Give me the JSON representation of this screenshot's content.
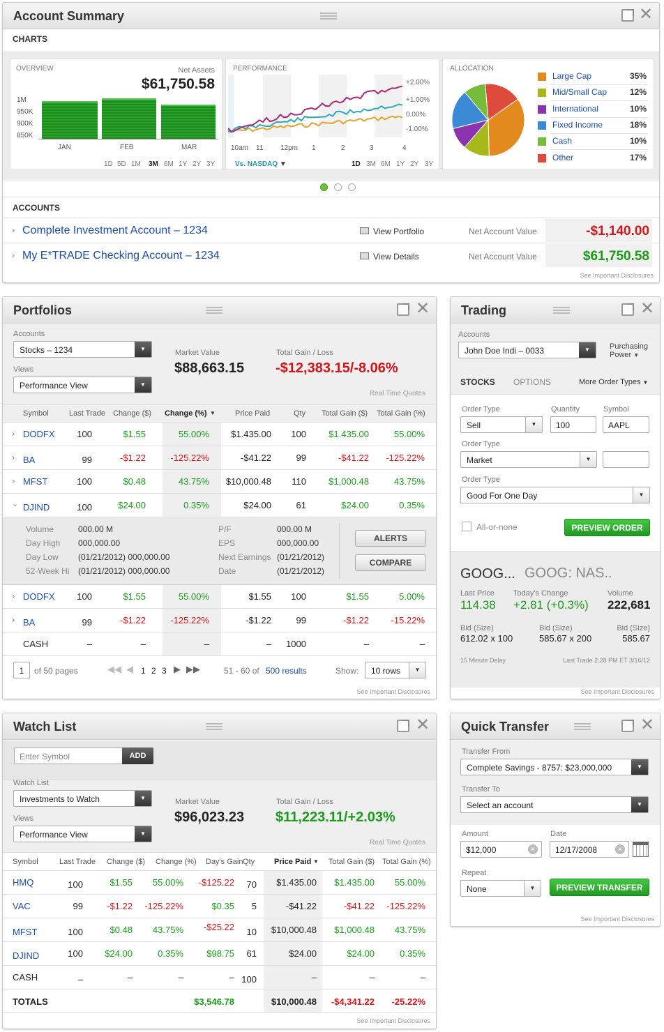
{
  "account_summary": {
    "title": "Account Summary",
    "charts_label": "CHARTS",
    "overview": {
      "label": "OVERVIEW",
      "net_assets_label": "Net Assets",
      "net_assets": "$61,750.58",
      "y_ticks": [
        "1M",
        "950K",
        "900K",
        "850K"
      ],
      "x_ticks": [
        "JAN",
        "FEB",
        "MAR"
      ],
      "ranges": [
        "1D",
        "5D",
        "1M",
        "3M",
        "6M",
        "1Y",
        "2Y",
        "3Y"
      ],
      "active_range": "3M"
    },
    "performance": {
      "label": "PERFORMANCE",
      "y_ticks": [
        "+2.00%",
        "+1.00%",
        "0.00%",
        "-1.00%"
      ],
      "x_ticks": [
        "10am",
        "11",
        "12pm",
        "1",
        "2",
        "3",
        "4"
      ],
      "vs": "Vs. NASDAQ",
      "ranges": [
        "1D",
        "3M",
        "6M",
        "1Y",
        "2Y",
        "3Y"
      ],
      "active_range": "1D"
    },
    "allocation": {
      "label": "ALLOCATION",
      "items": [
        {
          "name": "Large Cap",
          "pct": "35%",
          "color": "#e38a1f"
        },
        {
          "name": "Mid/Small Cap",
          "pct": "12%",
          "color": "#a6b81a"
        },
        {
          "name": "International",
          "pct": "10%",
          "color": "#8c33b0"
        },
        {
          "name": "Fixed Income",
          "pct": "18%",
          "color": "#3a8ad6"
        },
        {
          "name": "Cash",
          "pct": "10%",
          "color": "#77bb3a"
        },
        {
          "name": "Other",
          "pct": "17%",
          "color": "#de4a3c"
        }
      ]
    },
    "accounts_label": "ACCOUNTS",
    "accounts": [
      {
        "name": "Complete Investment Account – 1234",
        "action": "View Portfolio",
        "value_label": "Net Account Value",
        "value": "-$1,140.00"
      },
      {
        "name": "My E*TRADE Checking Account – 1234",
        "action": "View Details",
        "value_label": "Net Account Value",
        "value": "$61,750.58"
      }
    ],
    "disclosure": "See Important Disclosures"
  },
  "portfolios": {
    "title": "Portfolios",
    "accounts_label": "Accounts",
    "account": "Stocks – 1234",
    "views_label": "Views",
    "view": "Performance View",
    "market_value_label": "Market Value",
    "market_value": "$88,663.15",
    "total_gain_label": "Total Gain / Loss",
    "total_gain": "-$12,383.15/-8.06%",
    "rtq": "Real Time Quotes",
    "columns": [
      "Symbol",
      "Last Trade",
      "Change ($)",
      "Change (%)",
      "Price Paid",
      "Qty",
      "Total Gain ($)",
      "Total Gain (%)"
    ],
    "rows": [
      [
        "DODFX",
        "100",
        "$1.55",
        "55.00%",
        "$1.435.00",
        "100",
        "$1.435.00",
        "55.00%"
      ],
      [
        "BA",
        "99",
        "-$1.22",
        "-125.22%",
        "-$41.22",
        "99",
        "-$41.22",
        "-125.22%"
      ],
      [
        "MFST",
        "100",
        "$0.48",
        "43.75%",
        "$10,000.48",
        "110",
        "$1,000.48",
        "43.75%"
      ],
      [
        "DJIND",
        "100",
        "$24.00",
        "0.35%",
        "$24.00",
        "61",
        "$24.00",
        "0.35%"
      ]
    ],
    "detail": {
      "left_labels": [
        "Volume",
        "Day High",
        "Day Low",
        "52-Week Hi"
      ],
      "left_values": [
        "000.00 M",
        "000,000.00",
        "(01/21/2012)  000,000.00",
        "(01/21/2012)  000,000.00"
      ],
      "mid_labels": [
        "P/F",
        "EPS",
        "Next Earnings",
        "Date"
      ],
      "mid_values": [
        "000.00 M",
        "000,000.00",
        "(01/21/2012)",
        "(01/21/2012)"
      ],
      "alerts": "ALERTS",
      "compare": "COMPARE"
    },
    "rows2": [
      [
        "DODFX",
        "100",
        "$1.55",
        "55.00%",
        "$1.55",
        "100",
        "$1.55",
        "5.00%"
      ],
      [
        "BA",
        "99",
        "-$1.22",
        "-125.22%",
        "-$1.22",
        "99",
        "-$1.22",
        "-15.22%"
      ],
      [
        "CASH",
        "–",
        "–",
        "–",
        "–",
        "1000",
        "–",
        "–"
      ]
    ],
    "pager": {
      "page": "1",
      "of_pages": "of 50 pages",
      "pages": [
        "1",
        "2",
        "3"
      ],
      "range": "51 - 60 of",
      "results": "500 results",
      "show_label": "Show:",
      "show": "10 rows"
    },
    "disclosure": "See Important Disclosures"
  },
  "trading": {
    "title": "Trading",
    "accounts_label": "Accounts",
    "account": "John Doe Indi – 0033",
    "purchasing_power": "Purchasing",
    "purchasing_power2": "Power",
    "tabs": [
      "STOCKS",
      "OPTIONS"
    ],
    "more": "More Order Types",
    "order_type_label": "Order Type",
    "order_type": "Sell",
    "quantity_label": "Quantity",
    "quantity": "100",
    "symbol_label": "Symbol",
    "symbol": "AAPL",
    "order_type2_label": "Order Type",
    "order_type2": "Market",
    "order_type3_label": "Order Type",
    "order_type3": "Good For One Day",
    "all_or_none": "All-or-none",
    "preview": "PREVIEW ORDER",
    "quote": {
      "sym": "GOOG...",
      "exch": "GOOG: NAS..",
      "last_label": "Last Price",
      "last": "114.38",
      "chg_label": "Today's Change",
      "chg": "+2.81 (+0.3%)",
      "vol_label": "Volume",
      "vol": "222,681",
      "bid1_label": "Bid (Size)",
      "bid1": "612.02 x 100",
      "bid2_label": "Bid (Size)",
      "bid2": "585.67 x 200",
      "bid3_label": "Bid (Size)",
      "bid3": "585.67",
      "delay": "15 Minute Delay",
      "last_trade": "Last Trade 2:28 PM ET 3/16/12"
    },
    "disclosure": "See Important Disclosures"
  },
  "watchlist": {
    "title": "Watch List",
    "symbol_placeholder": "Enter Symbol",
    "add": "ADD",
    "wl_label": "Watch List",
    "wl": "Investments to Watch",
    "views_label": "Views",
    "view": "Performance View",
    "market_value_label": "Market Value",
    "market_value": "$96,023.23",
    "total_gain_label": "Total Gain / Loss",
    "total_gain": "$11,223.11/+2.03%",
    "rtq": "Real Time Quotes",
    "columns": [
      "Symbol",
      "Last Trade",
      "Change ($)",
      "Change (%)",
      "Day's Gain",
      "Qty",
      "Price Paid",
      "Total Gain ($)",
      "Total Gain (%)"
    ],
    "rows": [
      [
        "HMQ",
        "100",
        "$1.55",
        "55.00%",
        "-$125.22",
        "70",
        "$1.435.00",
        "$1.435.00",
        "55.00%"
      ],
      [
        "VAC",
        "99",
        "-$1.22",
        "-125.22%",
        "$0.35",
        "5",
        "-$41.22",
        "-$41.22",
        "-125.22%"
      ],
      [
        "MFST",
        "100",
        "$0.48",
        "43.75%",
        "-$25.22",
        "10",
        "$10,000.48",
        "$1,000.48",
        "43.75%"
      ],
      [
        "DJIND",
        "100",
        "$24.00",
        "0.35%",
        "$98.75",
        "61",
        "$24.00",
        "$24.00",
        "0.35%"
      ],
      [
        "CASH",
        "–",
        "–",
        "–",
        "–",
        "100",
        "–",
        "–",
        "–"
      ]
    ],
    "totals": {
      "label": "TOTALS",
      "days_gain": "$3,546.78",
      "price_paid": "$10,000.48",
      "gain": "-$4,341.22",
      "gain_pct": "-25.22%"
    },
    "disclosure": "See Important Disclosures"
  },
  "transfer": {
    "title": "Quick Transfer",
    "from_label": "Transfer From",
    "from": "Complete Savings - 8757: $23,000,000",
    "to_label": "Transfer To",
    "to": "Select an account",
    "amount_label": "Amount",
    "amount": "$12,000",
    "date_label": "Date",
    "date": "12/17/2008",
    "repeat_label": "Repeat",
    "repeat": "None",
    "preview": "PREVIEW TRANSFER",
    "disclosure": "See Important Disclosures"
  }
}
